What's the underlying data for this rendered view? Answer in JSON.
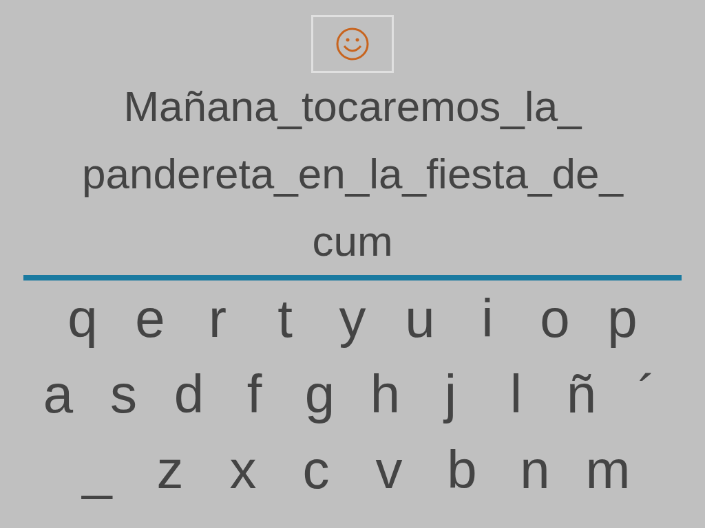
{
  "hint_button": {
    "kind": "smiley"
  },
  "sentence_lines": [
    "Mañana_tocaremos_la_",
    "pandereta_en_la_fiesta_de_",
    "cum"
  ],
  "keyboard_rows": [
    [
      "q",
      "e",
      "r",
      "t",
      "y",
      "u",
      "i",
      "o",
      "p"
    ],
    [
      "a",
      "s",
      "d",
      "f",
      "g",
      "h",
      "j",
      "l",
      "ñ",
      "´"
    ],
    [
      "_",
      "z",
      "x",
      "c",
      "v",
      "b",
      "n",
      "m"
    ]
  ]
}
